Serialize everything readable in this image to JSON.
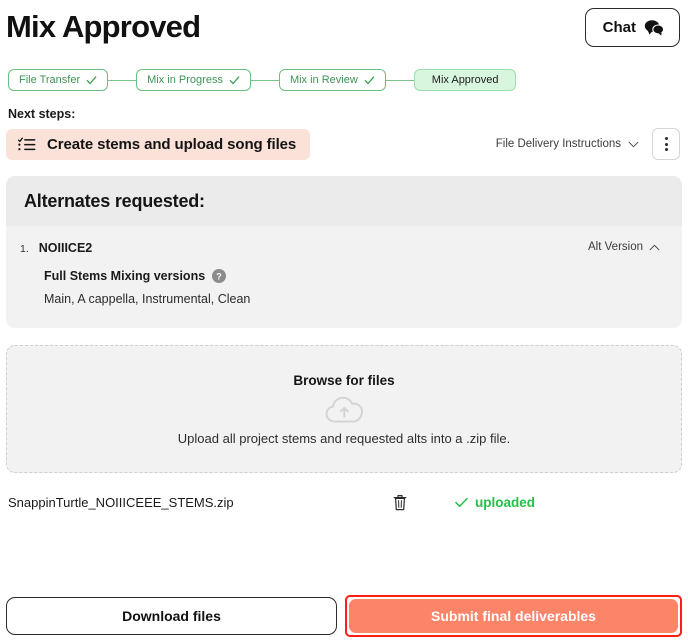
{
  "header": {
    "title": "Mix Approved",
    "chat_label": "Chat",
    "chat_icon": "chat-bubbles-icon"
  },
  "stepper": {
    "steps": [
      {
        "label": "File Transfer",
        "state": "complete",
        "icon": "check-icon"
      },
      {
        "label": "Mix in Progress",
        "state": "complete",
        "icon": "check-icon"
      },
      {
        "label": "Mix in Review",
        "state": "complete",
        "icon": "check-icon"
      },
      {
        "label": "Mix Approved",
        "state": "active",
        "icon": ""
      }
    ]
  },
  "next_steps": {
    "label": "Next steps:",
    "banner_text": "Create stems and upload song files",
    "banner_icon": "checklist-icon",
    "banner_bg": "#fbe2d8",
    "file_delivery_label": "File Delivery Instructions",
    "file_delivery_icon": "chevron-down-icon",
    "menu_icon": "kebab-menu-icon"
  },
  "alternates": {
    "title": "Alternates requested:",
    "items": [
      {
        "index": "1.",
        "name": "NOIIICE2",
        "version_label": "Alt Version",
        "version_icon": "chevron-up-icon",
        "sub_title": "Full Stems Mixing versions",
        "help_icon": "help-circle-icon",
        "values": "Main, A cappella, Instrumental, Clean"
      }
    ]
  },
  "dropzone": {
    "title": "Browse for files",
    "icon": "cloud-upload-icon",
    "subtitle": "Upload all project stems and requested alts into a .zip file."
  },
  "file": {
    "name": "SnappinTurtle_NOIIICEEE_STEMS.zip",
    "delete_icon": "trash-icon",
    "status_icon": "check-icon",
    "status_label": "uploaded",
    "status_color": "#25bf4a"
  },
  "footer": {
    "download_label": "Download files",
    "submit_label": "Submit final deliverables",
    "submit_bg": "#fb8469",
    "highlight_color": "#ff1d16"
  }
}
